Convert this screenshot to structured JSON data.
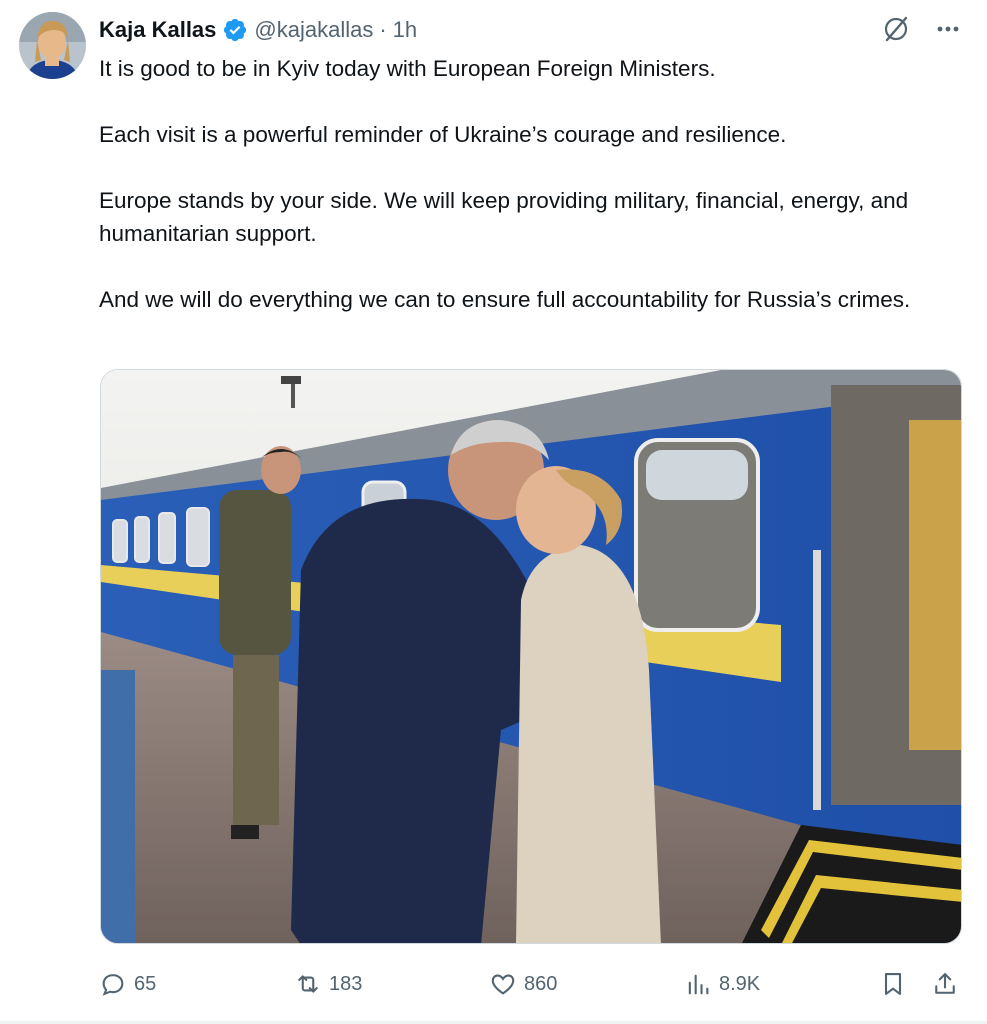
{
  "author": {
    "display_name": "Kaja Kallas",
    "handle": "@kajakallas",
    "separator": "·",
    "time": "1h",
    "verified": true,
    "avatar_icon": "profile-photo"
  },
  "top_actions": {
    "grok_icon": "grok-icon",
    "more_icon": "more-icon"
  },
  "tweet": {
    "paragraphs": [
      "It is good to be in Kyiv today with European Foreign Ministers.",
      "Each visit is a powerful reminder of Ukraine’s courage and resilience.",
      "Europe stands by your side. We will keep providing military, financial, energy, and humanitarian support.",
      "And we will do everything we can to ensure full accountability for Russia’s crimes."
    ]
  },
  "media": {
    "icon": "photo"
  },
  "actions": {
    "replies": "65",
    "reposts": "183",
    "likes": "860",
    "views": "8.9K"
  },
  "colors": {
    "text": "#0f1419",
    "muted": "#536471",
    "verified_blue": "#1d9bf0",
    "train_blue": "#1f4fa8",
    "stripe_yellow": "#e8cf5a"
  }
}
